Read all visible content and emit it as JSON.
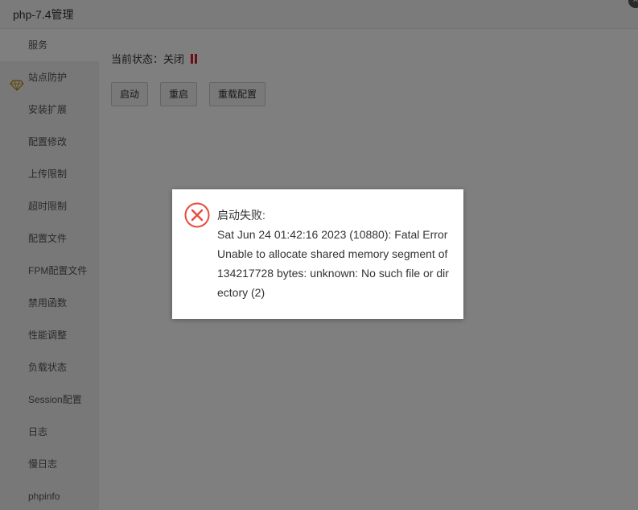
{
  "window": {
    "title": "php-7.4管理",
    "close_symbol": "✕"
  },
  "sidebar": {
    "items": [
      {
        "label": "服务",
        "active": true
      },
      {
        "label": "站点防护",
        "icon": "gem-icon"
      },
      {
        "label": "安装扩展"
      },
      {
        "label": "配置修改"
      },
      {
        "label": "上传限制"
      },
      {
        "label": "超时限制"
      },
      {
        "label": "配置文件"
      },
      {
        "label": "FPM配置文件"
      },
      {
        "label": "禁用函数"
      },
      {
        "label": "性能调整"
      },
      {
        "label": "负载状态"
      },
      {
        "label": "Session配置"
      },
      {
        "label": "日志"
      },
      {
        "label": "慢日志"
      },
      {
        "label": "phpinfo"
      }
    ]
  },
  "main": {
    "status_label": "当前状态：",
    "status_value": "关闭",
    "status_color": "#d21f2b",
    "buttons": {
      "start": "启动",
      "restart": "重启",
      "reload": "重载配置"
    }
  },
  "dialog": {
    "icon": "error-circle-x-icon",
    "icon_color": "#e64b3c",
    "heading": "启动失败:",
    "message": "Sat Jun 24 01:42:16 2023 (10880): Fatal Error Unable to allocate shared memory segment of 134217728 bytes: unknown: No such file or directory (2)"
  }
}
